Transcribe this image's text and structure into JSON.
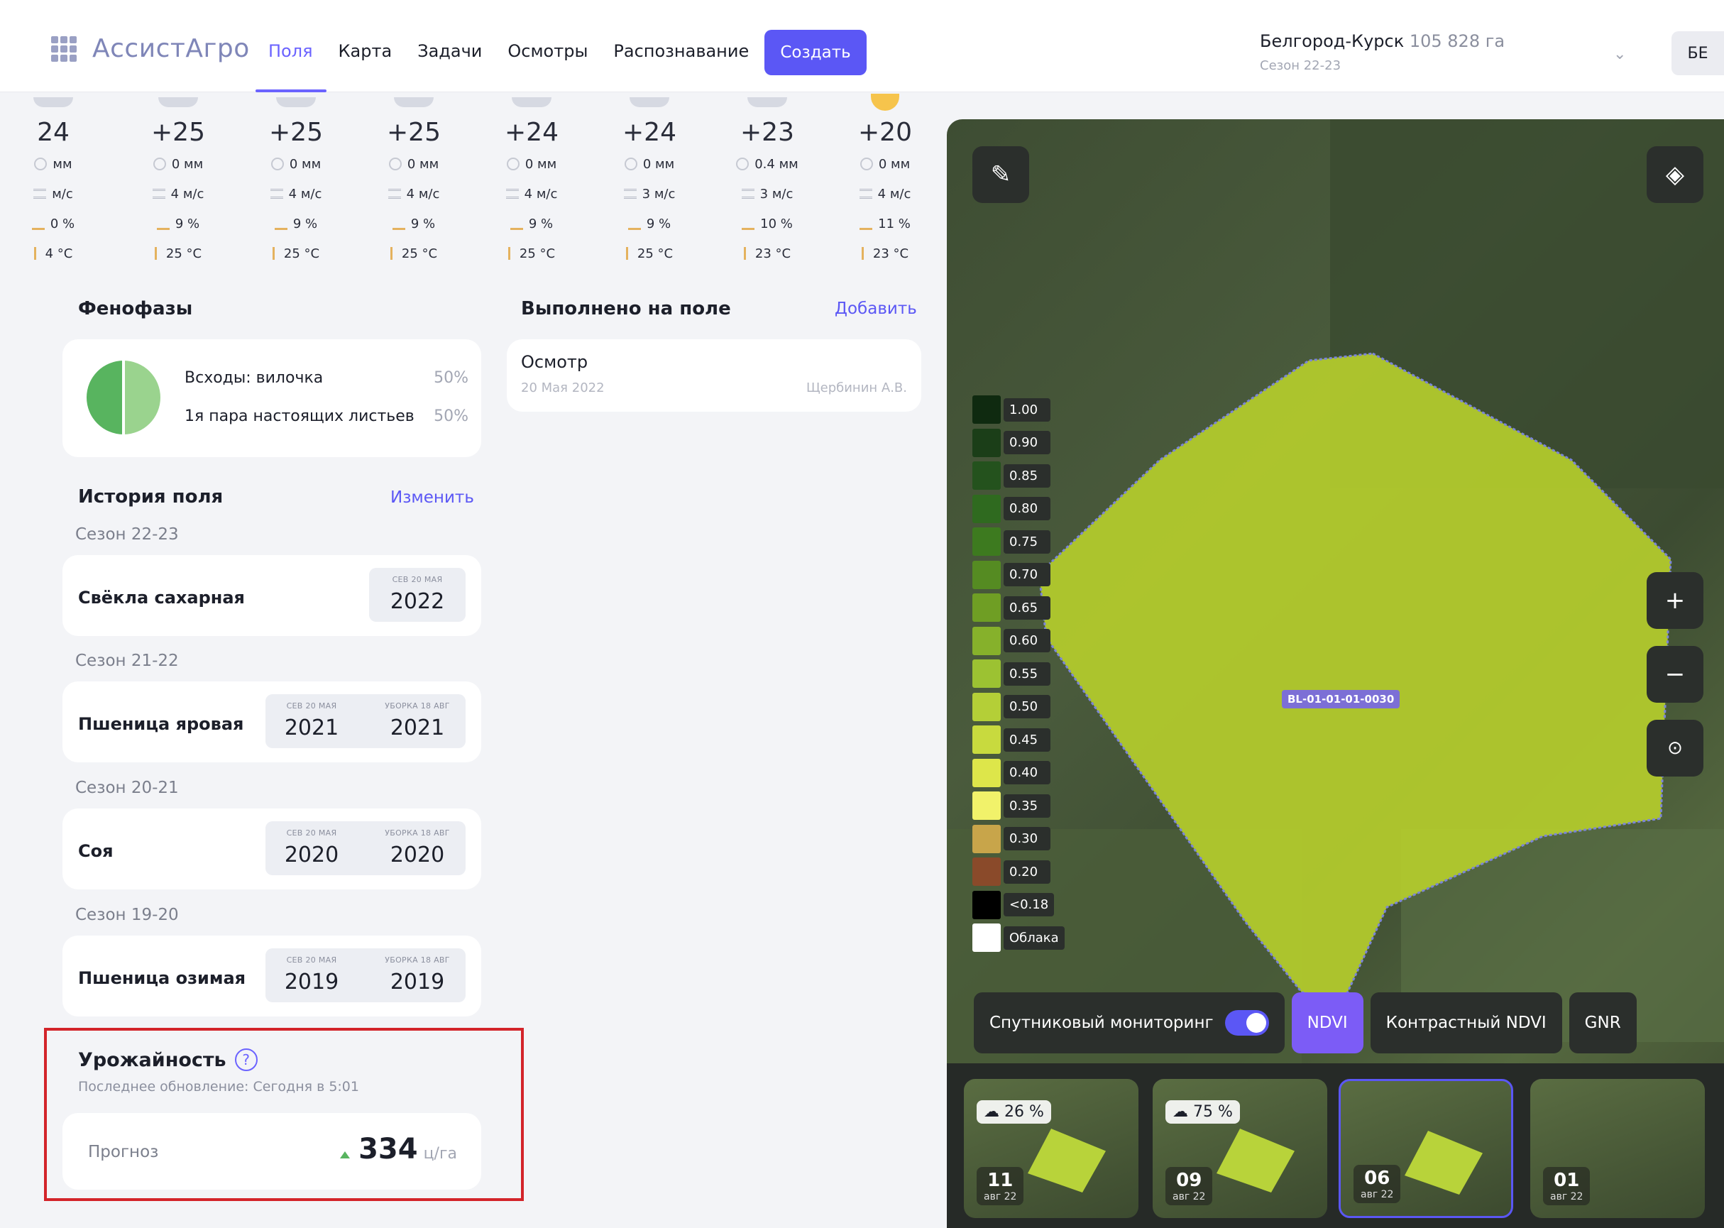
{
  "header": {
    "logo_text": "АссистАгро",
    "nav": [
      "Поля",
      "Карта",
      "Задачи",
      "Осмотры",
      "Распознавание"
    ],
    "create_label": "Создать",
    "farm_name": "Белгород-Курск",
    "farm_area": "105 828 га",
    "farm_season": "Сезон 22-23",
    "avatar": "БЕ"
  },
  "weather": [
    {
      "icon": "cloud-icon",
      "temp": "24",
      "precip": "мм",
      "wind": "м/с",
      "hum": "0 %",
      "tmax": "4 °C"
    },
    {
      "icon": "cloud-icon",
      "temp": "+25",
      "precip": "0 мм",
      "wind": "4 м/с",
      "hum": "9 %",
      "tmax": "25 °C"
    },
    {
      "icon": "cloud-icon",
      "temp": "+25",
      "precip": "0 мм",
      "wind": "4 м/с",
      "hum": "9 %",
      "tmax": "25 °C"
    },
    {
      "icon": "cloud-icon",
      "temp": "+25",
      "precip": "0 мм",
      "wind": "4 м/с",
      "hum": "9 %",
      "tmax": "25 °C"
    },
    {
      "icon": "cloud-icon",
      "temp": "+24",
      "precip": "0 мм",
      "wind": "4 м/с",
      "hum": "9 %",
      "tmax": "25 °C"
    },
    {
      "icon": "cloud-icon",
      "temp": "+24",
      "precip": "0 мм",
      "wind": "3 м/с",
      "hum": "9 %",
      "tmax": "25 °C"
    },
    {
      "icon": "cloud-icon",
      "temp": "+23",
      "precip": "0.4 мм",
      "wind": "3 м/с",
      "hum": "10 %",
      "tmax": "23 °C"
    },
    {
      "icon": "sun-icon",
      "temp": "+20",
      "precip": "0 мм",
      "wind": "4 м/с",
      "hum": "11 %",
      "tmax": "23 °C"
    }
  ],
  "phenophases": {
    "title": "Фенофазы",
    "items": [
      {
        "label": "Всходы: вилочка",
        "pct": "50%"
      },
      {
        "label": "1я пара настоящих листьев",
        "pct": "50%"
      }
    ]
  },
  "done": {
    "title": "Выполнено на поле",
    "add_label": "Добавить",
    "item": {
      "title": "Осмотр",
      "date": "20 Мая 2022",
      "person": "Щербинин А.В."
    }
  },
  "history": {
    "title": "История поля",
    "edit_label": "Изменить",
    "seasons": [
      {
        "season": "Сезон 22-23",
        "crop": "Свёкла сахарная",
        "dates": [
          {
            "small": "СЕВ 20 МАЯ",
            "year": "2022"
          }
        ]
      },
      {
        "season": "Сезон 21-22",
        "crop": "Пшеница яровая",
        "dates": [
          {
            "small": "СЕВ 20 МАЯ",
            "year": "2021"
          },
          {
            "small": "УБОРКА 18 АВГ",
            "year": "2021"
          }
        ]
      },
      {
        "season": "Сезон 20-21",
        "crop": "Соя",
        "dates": [
          {
            "small": "СЕВ 20 МАЯ",
            "year": "2020"
          },
          {
            "small": "УБОРКА 18 АВГ",
            "year": "2020"
          }
        ]
      },
      {
        "season": "Сезон 19-20",
        "crop": "Пшеница озимая",
        "dates": [
          {
            "small": "СЕВ 20 МАЯ",
            "year": "2019"
          },
          {
            "small": "УБОРКА 18 АВГ",
            "year": "2019"
          }
        ]
      }
    ]
  },
  "yield": {
    "title": "Урожайность",
    "help": "?",
    "updated": "Последнее обновление: Сегодня в 5:01",
    "forecast_label": "Прогноз",
    "forecast_value": "334",
    "unit": "ц/га"
  },
  "map": {
    "field_id": "BL-01-01-01-0030",
    "legend": [
      {
        "label": "1.00",
        "color": "#0f2a10"
      },
      {
        "label": "0.90",
        "color": "#1b3e18"
      },
      {
        "label": "0.85",
        "color": "#24521d"
      },
      {
        "label": "0.80",
        "color": "#2f6a1f"
      },
      {
        "label": "0.75",
        "color": "#3d7a1f"
      },
      {
        "label": "0.70",
        "color": "#558b22"
      },
      {
        "label": "0.65",
        "color": "#6f9e24"
      },
      {
        "label": "0.60",
        "color": "#86b12b"
      },
      {
        "label": "0.55",
        "color": "#9cc232"
      },
      {
        "label": "0.50",
        "color": "#b4cf37"
      },
      {
        "label": "0.45",
        "color": "#c8da3e"
      },
      {
        "label": "0.40",
        "color": "#dde64a"
      },
      {
        "label": "0.35",
        "color": "#f1f26a"
      },
      {
        "label": "0.30",
        "color": "#c8a54a"
      },
      {
        "label": "0.20",
        "color": "#8a4a2a"
      },
      {
        "label": "<0.18",
        "color": "#000000"
      },
      {
        "label": "Облака",
        "color": "#ffffff"
      }
    ],
    "monitoring_label": "Спутниковый мониторинг",
    "layers": [
      "NDVI",
      "Контрастный NDVI",
      "GNR"
    ],
    "thumbnails": [
      {
        "cloud": "26 %",
        "day": "11",
        "month": "авг 22"
      },
      {
        "cloud": "75 %",
        "day": "09",
        "month": "авг 22"
      },
      {
        "cloud": "",
        "day": "06",
        "month": "авг 22"
      },
      {
        "cloud": "",
        "day": "01",
        "month": "авг 22"
      }
    ]
  }
}
